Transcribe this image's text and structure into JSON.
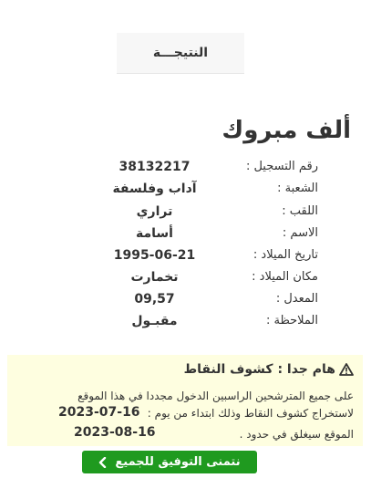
{
  "tab": {
    "label": "النتيجـــة"
  },
  "result": {
    "title": "ألف مبروك"
  },
  "fields": [
    {
      "label": "رقم التسجيل :",
      "value": "38132217"
    },
    {
      "label": "الشعبة :",
      "value": "آداب وفلسفة"
    },
    {
      "label": "اللقب :",
      "value": "تراري"
    },
    {
      "label": "الاسم :",
      "value": "أسامة"
    },
    {
      "label": "تاريخ الميلاد :",
      "value": "1995-06-21"
    },
    {
      "label": "مكان الميلاد :",
      "value": "تخمارت"
    },
    {
      "label": "المعدل :",
      "value": "09,57"
    },
    {
      "label": "الملاحظة :",
      "value": "مقبـول"
    }
  ],
  "notice": {
    "title": "هام جدا : كشوف النقاط",
    "line1": "على جميع المترشحين الراسبين الدخول مجددا في هذا الموقع",
    "line2": "لاستخراج كشوف النقاط وذلك ابتداء من يوم :",
    "date_start": "2023-07-16",
    "line3": "الموقع سيغلق في حدود .",
    "date_end": "2023-08-16"
  },
  "button": {
    "label": "نتمنى التوفيق للجميع"
  },
  "colors": {
    "button_bg": "#1f9a1f",
    "notice_bg": "#fefee0"
  },
  "icons": {
    "notice": "warning-triangle-icon",
    "button": "chevron-left-icon"
  }
}
